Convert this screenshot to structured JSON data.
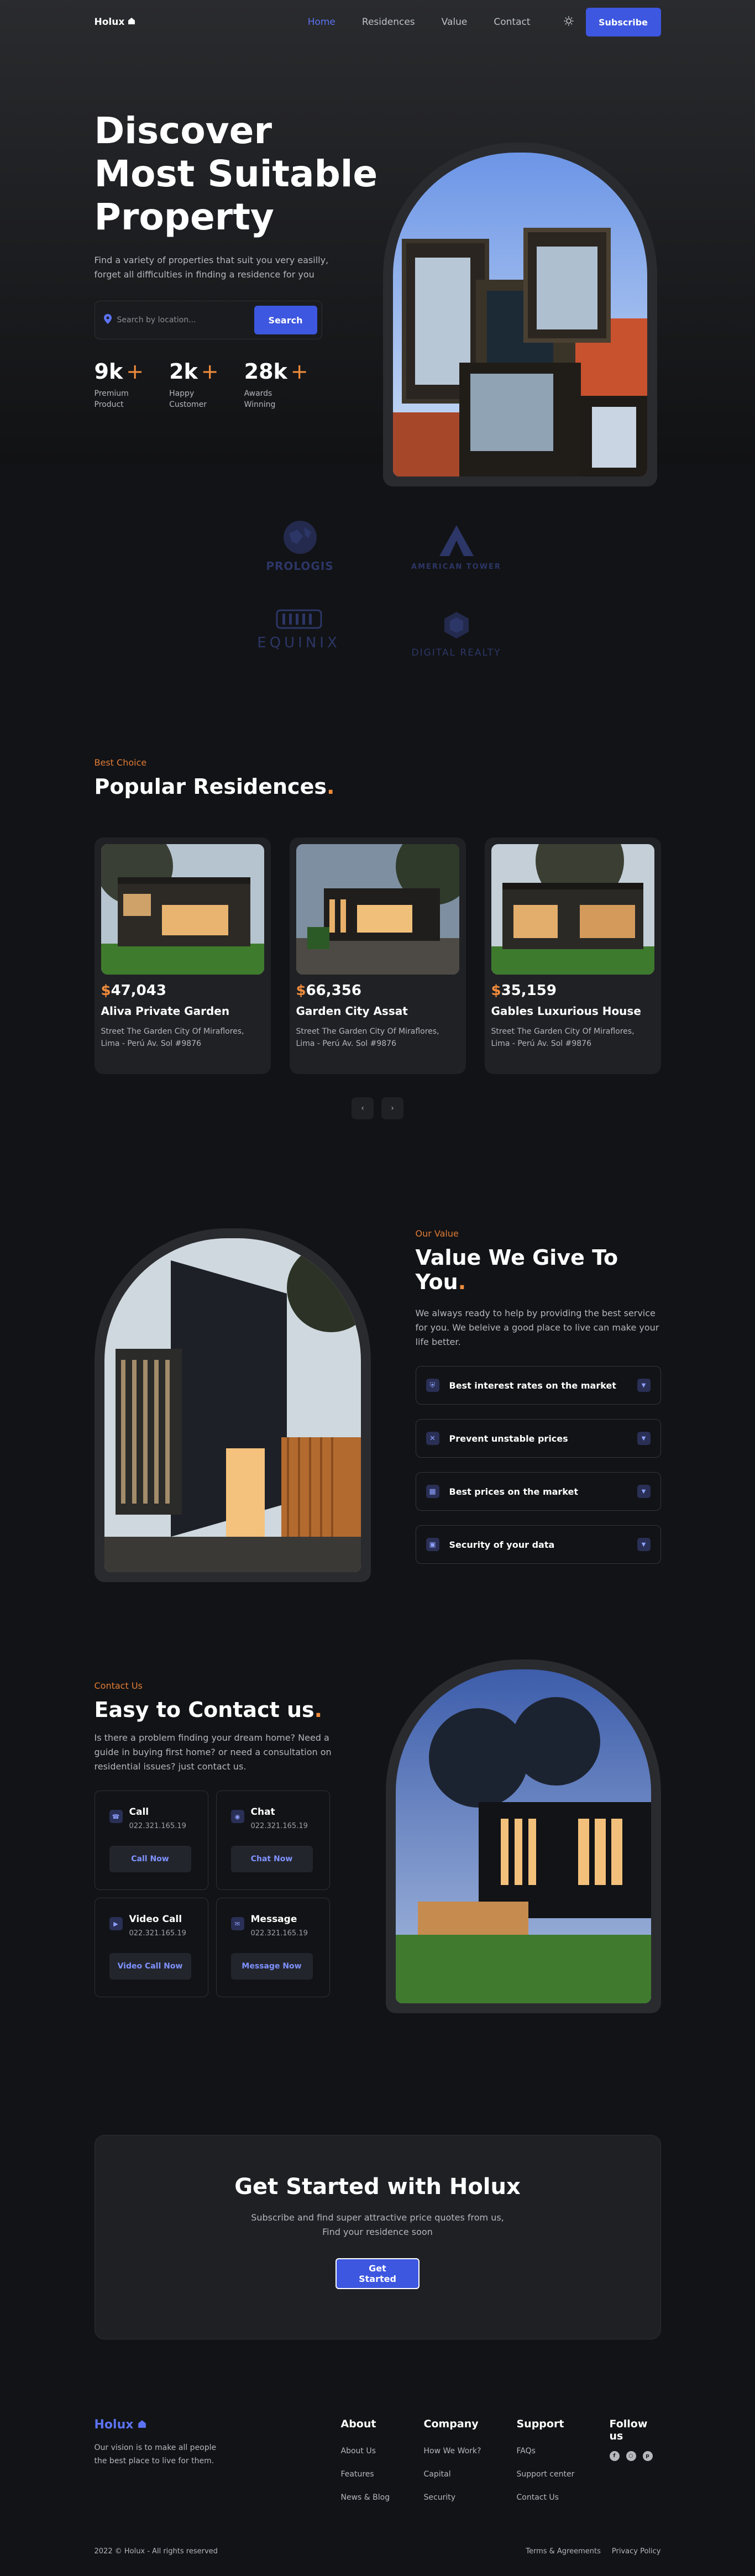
{
  "nav": {
    "brand": "Holux",
    "links": [
      "Home",
      "Residences",
      "Value",
      "Contact"
    ],
    "subscribe": "Subscribe"
  },
  "hero": {
    "title_l1": "Discover",
    "title_l2": "Most Suitable",
    "title_l3": "Property",
    "description": "Find a variety of properties that suit you very easilly, forget all difficulties in finding a residence for you",
    "search_placeholder": "Search by location...",
    "search_button": "Search",
    "stats": [
      {
        "value": "9k",
        "plus": "+",
        "label": "Premium Product"
      },
      {
        "value": "2k",
        "plus": "+",
        "label": "Happy Customer"
      },
      {
        "value": "28k",
        "plus": "+",
        "label": "Awards Winning"
      }
    ]
  },
  "logos": [
    "PROLOGIS",
    "AMERICAN TOWER",
    "EQUINIX",
    "DIGITAL REALTY"
  ],
  "residences": {
    "tag": "Best Choice",
    "title": "Popular Residences",
    "cards": [
      {
        "currency": "$",
        "price": "47,043",
        "name": "Aliva Private Garden",
        "address": "Street The Garden City Of Miraflores, Lima - Perú Av. Sol #9876"
      },
      {
        "currency": "$",
        "price": "66,356",
        "name": "Garden City Assat",
        "address": "Street The Garden City Of Miraflores, Lima - Perú Av. Sol #9876"
      },
      {
        "currency": "$",
        "price": "35,159",
        "name": "Gables Luxurious House",
        "address": "Street The Garden City Of Miraflores, Lima - Perú Av. Sol #9876"
      }
    ]
  },
  "value": {
    "tag": "Our Value",
    "title": "Value We Give To You",
    "description": "We always ready to help by providing the best service for you. We beleive a good place to live can make your life better.",
    "items": [
      "Best interest rates on the market",
      "Prevent unstable prices",
      "Best prices on the market",
      "Security of your data"
    ]
  },
  "contact": {
    "tag": "Contact Us",
    "title": "Easy to Contact us",
    "description": "Is there a problem finding your dream home? Need a guide in buying first home? or need a consultation on residential issues? just contact us.",
    "boxes": [
      {
        "title": "Call",
        "number": "022.321.165.19",
        "button": "Call Now"
      },
      {
        "title": "Chat",
        "number": "022.321.165.19",
        "button": "Chat Now"
      },
      {
        "title": "Video Call",
        "number": "022.321.165.19",
        "button": "Video Call Now"
      },
      {
        "title": "Message",
        "number": "022.321.165.19",
        "button": "Message Now"
      }
    ]
  },
  "cta": {
    "title": "Get Started with Holux",
    "description": "Subscribe and find super attractive price quotes from us, Find your residence soon",
    "button": "Get Started"
  },
  "footer": {
    "brand": "Holux",
    "description": "Our vision is to make all people the best place to live for them.",
    "about": {
      "title": "About",
      "links": [
        "About Us",
        "Features",
        "News & Blog"
      ]
    },
    "company": {
      "title": "Company",
      "links": [
        "How We Work?",
        "Capital",
        "Security"
      ]
    },
    "support": {
      "title": "Support",
      "links": [
        "FAQs",
        "Support center",
        "Contact Us"
      ]
    },
    "follow": "Follow us",
    "copyright": "2022 © Holux - All rights reserved",
    "terms": "Terms & Agreements",
    "privacy": "Privacy Policy"
  },
  "colors": {
    "accent": "#3d57e0",
    "orange": "#f08c3c",
    "background": "#121316"
  }
}
